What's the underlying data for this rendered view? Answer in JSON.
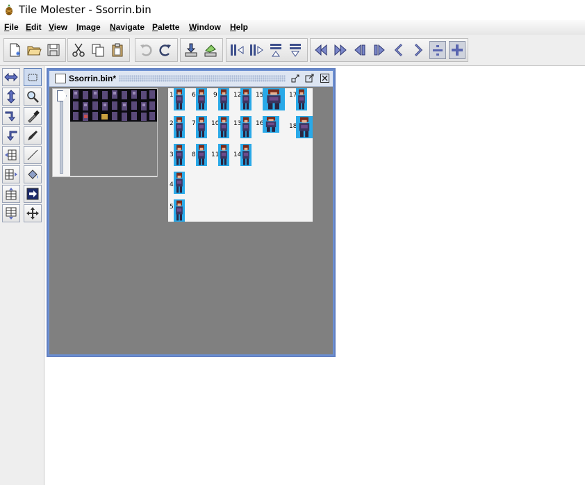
{
  "window": {
    "title": "Tile Molester - Ssorrin.bin"
  },
  "menu": [
    "File",
    "Edit",
    "View",
    "Image",
    "Navigate",
    "Palette",
    "Window",
    "Help"
  ],
  "toolbar_icons": [
    "new-file-icon",
    "open-folder-icon",
    "save-icon",
    "cut-icon",
    "copy-icon",
    "paste-icon",
    "undo-icon",
    "redo-icon",
    "import-icon",
    "export-icon",
    "shift-columns-left-icon",
    "shift-columns-right-icon",
    "shift-rows-up-icon",
    "shift-rows-down-icon",
    "jump-page-back-icon",
    "jump-page-forward-icon",
    "row-back-icon",
    "row-forward-icon",
    "byte-back-icon",
    "byte-forward-icon",
    "decrease-columns-icon",
    "increase-columns-icon"
  ],
  "tools": [
    "mirror-horizontal-icon",
    "selection-icon",
    "mirror-vertical-icon",
    "zoom-icon",
    "rotate-right-icon",
    "pick-color-icon",
    "rotate-left-icon",
    "pencil-icon",
    "shift-horizontal-icon",
    "line-icon",
    "shift-left-icon",
    "flood-fill-icon",
    "shift-up-icon",
    "replace-color-icon",
    "shift-down-icon",
    "move-icon"
  ],
  "doc": {
    "title": "Ssorrin.bin*"
  },
  "sprites": {
    "numbers": [
      "1",
      "6",
      "9",
      "12",
      "15",
      "17",
      "2",
      "7",
      "10",
      "13",
      "16",
      "18",
      "3",
      "8",
      "11",
      "14",
      "4",
      "5"
    ]
  },
  "colors": {
    "sprite_bg": "#29a9e8",
    "desktop": "#808080",
    "frame": "#6b8fd2"
  }
}
